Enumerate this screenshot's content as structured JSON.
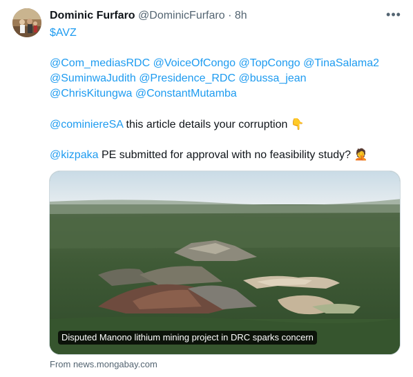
{
  "tweet": {
    "author_name": "Dominic Furfaro",
    "author_handle": "@DominicFurfaro",
    "separator": "·",
    "time": "8h",
    "more": "•••",
    "cashtag": "$AVZ",
    "mentions_line1": "@Com_mediasRDC @VoiceOfCongo @TopCongo @TinaSalama2",
    "mentions_line2": "@SuminwaJudith @Presidence_RDC @bussa_jean",
    "mentions_line3": "@ChrisKitungwa @ConstantMutamba",
    "mention_a": "@cominiereSA",
    "text_a": " this article details your corruption ",
    "emoji_a": "👇",
    "mention_b": "@kizpaka",
    "text_b": " PE submitted for approval with no feasibility study? ",
    "emoji_b": "🤦"
  },
  "card": {
    "caption": "Disputed Manono lithium mining project in DRC sparks concern",
    "source": "From news.mongabay.com"
  }
}
